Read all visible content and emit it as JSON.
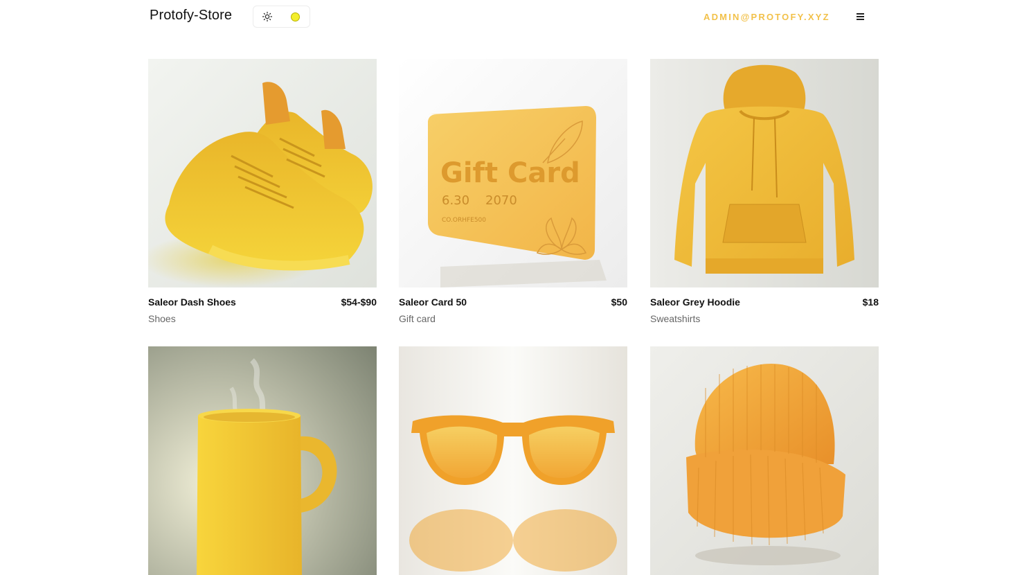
{
  "header": {
    "logo": "Protofy-Store",
    "user_email": "ADMIN@PROTOFY.XYZ",
    "accent_color": "#F2C14A",
    "theme_dot_color": "#F3EE2C",
    "theme_icon": "sun-icon",
    "menu_icon": "hamburger-menu-icon"
  },
  "products": [
    {
      "name": "Saleor Dash Shoes",
      "price": "$54-$90",
      "category": "Shoes",
      "image": "yellow-sneakers"
    },
    {
      "name": "Saleor Card 50",
      "price": "$50",
      "category": "Gift card",
      "image": "gift-card",
      "image_text": {
        "title": "Gift Card",
        "line1a": "6.30",
        "line1b": "2070",
        "line2": "CO.ORHFE500"
      }
    },
    {
      "name": "Saleor Grey Hoodie",
      "price": "$18",
      "category": "Sweatshirts",
      "image": "yellow-hoodie"
    },
    {
      "name": "",
      "price": "",
      "category": "",
      "image": "yellow-mug"
    },
    {
      "name": "",
      "price": "",
      "category": "",
      "image": "orange-sunglasses"
    },
    {
      "name": "",
      "price": "",
      "category": "",
      "image": "orange-beanie"
    }
  ]
}
